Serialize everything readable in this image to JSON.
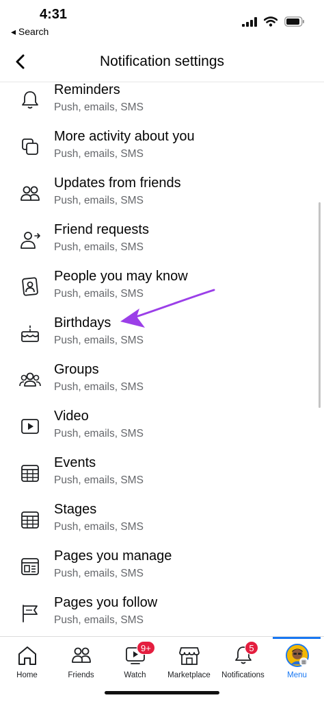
{
  "status": {
    "time": "4:31",
    "back_label": "◂ Search"
  },
  "header": {
    "title": "Notification settings"
  },
  "rows": [
    {
      "title": "Reminders",
      "subtitle": "Push, emails, SMS",
      "icon": "bell-icon"
    },
    {
      "title": "More activity about you",
      "subtitle": "Push, emails, SMS",
      "icon": "squares-icon"
    },
    {
      "title": "Updates from friends",
      "subtitle": "Push, emails, SMS",
      "icon": "friends-icon"
    },
    {
      "title": "Friend requests",
      "subtitle": "Push, emails, SMS",
      "icon": "friend-request-icon"
    },
    {
      "title": "People you may know",
      "subtitle": "Push, emails, SMS",
      "icon": "people-photo-icon"
    },
    {
      "title": "Birthdays",
      "subtitle": "Push, emails, SMS",
      "icon": "birthday-cake-icon"
    },
    {
      "title": "Groups",
      "subtitle": "Push, emails, SMS",
      "icon": "groups-icon"
    },
    {
      "title": "Video",
      "subtitle": "Push, emails, SMS",
      "icon": "video-icon"
    },
    {
      "title": "Events",
      "subtitle": "Push, emails, SMS",
      "icon": "calendar-icon"
    },
    {
      "title": "Stages",
      "subtitle": "Push, emails, SMS",
      "icon": "stages-grid-icon"
    },
    {
      "title": "Pages you manage",
      "subtitle": "Push, emails, SMS",
      "icon": "page-manage-icon"
    },
    {
      "title": "Pages you follow",
      "subtitle": "Push, emails, SMS",
      "icon": "flag-icon"
    }
  ],
  "tabs": [
    {
      "label": "Home",
      "icon": "home-icon"
    },
    {
      "label": "Friends",
      "icon": "friends-icon"
    },
    {
      "label": "Watch",
      "icon": "watch-icon",
      "badge": "9+"
    },
    {
      "label": "Marketplace",
      "icon": "marketplace-icon"
    },
    {
      "label": "Notifications",
      "icon": "bell-icon",
      "badge": "5"
    },
    {
      "label": "Menu",
      "icon": "avatar",
      "active": true
    }
  ],
  "colors": {
    "accent": "#1877f2",
    "badge": "#e41e3f",
    "annotation_arrow": "#9b3fe8",
    "subtitle": "#65676b"
  }
}
